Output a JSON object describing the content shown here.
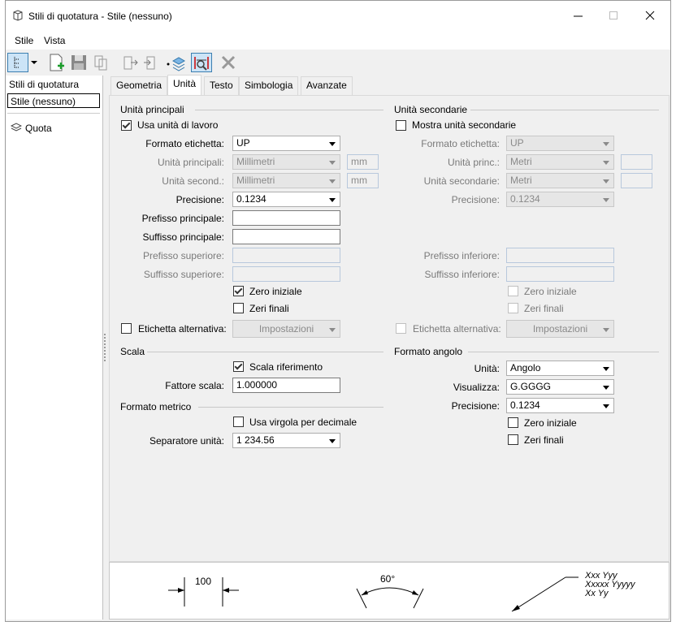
{
  "window": {
    "title": "Stili di quotatura -  Stile (nessuno)"
  },
  "menu": [
    "Stile",
    "Vista"
  ],
  "tree": {
    "header": "Stili di quotatura",
    "selected": "Stile (nessuno)",
    "item": "Quota"
  },
  "tabs": [
    "Geometria",
    "Unità",
    "Testo",
    "Simbologia",
    "Avanzate"
  ],
  "primary": {
    "section": "Unità principali",
    "use_work_units": "Usa unità di lavoro",
    "label_format_label": "Formato etichetta:",
    "label_format_value": "UP",
    "primary_units_label": "Unità principali:",
    "primary_units_value": "Millimetri",
    "primary_units_abbr": "mm",
    "secondary_units_label": "Unità second.:",
    "secondary_units_value": "Millimetri",
    "secondary_units_abbr": "mm",
    "precision_label": "Precisione:",
    "precision_value": "0.1234",
    "main_prefix_label": "Prefisso principale:",
    "main_suffix_label": "Suffisso principale:",
    "upper_prefix_label": "Prefisso superiore:",
    "upper_suffix_label": "Suffisso superiore:",
    "leading_zero": "Zero iniziale",
    "trailing_zeros": "Zeri finali",
    "alt_label": "Etichetta alternativa:",
    "alt_button": "Impostazioni"
  },
  "secondary": {
    "section": "Unità secondarie",
    "show": "Mostra unità secondarie",
    "label_format_label": "Formato etichetta:",
    "label_format_value": "UP",
    "primary_units_label": "Unità princ.:",
    "primary_units_value": "Metri",
    "secondary_units_label": "Unità secondarie:",
    "secondary_units_value": "Metri",
    "precision_label": "Precisione:",
    "precision_value": "0.1234",
    "lower_prefix_label": "Prefisso inferiore:",
    "lower_suffix_label": "Suffisso inferiore:",
    "leading_zero": "Zero iniziale",
    "trailing_zeros": "Zeri finali",
    "alt_label": "Etichetta alternativa:",
    "alt_button": "Impostazioni"
  },
  "scale": {
    "section": "Scala",
    "scale_ref": "Scala riferimento",
    "factor_label": "Fattore scala:",
    "factor_value": "1.000000"
  },
  "metric": {
    "section": "Formato metrico",
    "comma": "Usa virgola per decimale",
    "separator_label": "Separatore unità:",
    "separator_value": "1 234.56"
  },
  "angle": {
    "section": "Formato angolo",
    "unit_label": "Unità:",
    "unit_value": "Angolo",
    "display_label": "Visualizza:",
    "display_value": "G.GGGG",
    "precision_label": "Precisione:",
    "precision_value": "0.1234",
    "leading_zero": "Zero iniziale",
    "trailing_zeros": "Zeri finali"
  },
  "preview": {
    "linear": "100",
    "angle": "60°",
    "note_line1": "Xxx Yyy",
    "note_line2": "Xxxxx Yyyyy",
    "note_line3": "Xx Yy"
  }
}
